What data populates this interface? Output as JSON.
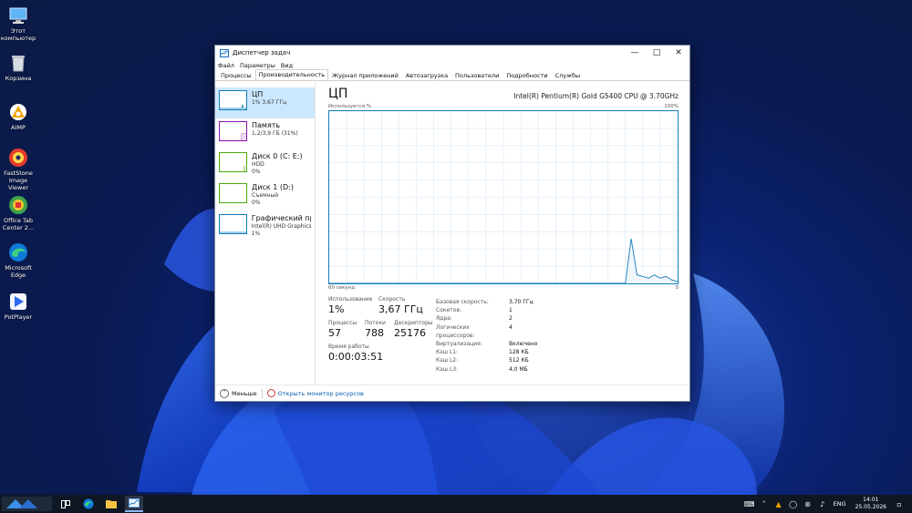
{
  "desktop": {
    "icons": [
      {
        "label": "Этот компьютер",
        "icon": "computer-icon"
      },
      {
        "label": "Корзина",
        "icon": "recycle-bin-icon"
      },
      {
        "label": "AIMP",
        "icon": "aimp-icon"
      },
      {
        "label": "FastStone Image Viewer",
        "icon": "faststone-icon"
      },
      {
        "label": "Office Tab Center 2...",
        "icon": "office-tab-icon"
      },
      {
        "label": "Microsoft Edge",
        "icon": "edge-icon"
      },
      {
        "label": "PotPlayer",
        "icon": "potplayer-icon"
      }
    ]
  },
  "window": {
    "title": "Диспетчер задач",
    "menu": [
      "Файл",
      "Параметры",
      "Вид"
    ],
    "tabs": [
      "Процессы",
      "Производительность",
      "Журнал приложений",
      "Автозагрузка",
      "Пользователи",
      "Подробности",
      "Службы"
    ],
    "active_tab": "Производительность",
    "sidebar": [
      {
        "name": "ЦП",
        "detail1": "1%  3,67 ГГц",
        "detail2": ""
      },
      {
        "name": "Память",
        "detail1": "1,2/3,9 ГБ (31%)",
        "detail2": ""
      },
      {
        "name": "Диск 0 (C: E:)",
        "detail1": "HDD",
        "detail2": "0%"
      },
      {
        "name": "Диск 1 (D:)",
        "detail1": "Съемный",
        "detail2": "0%"
      },
      {
        "name": "Графический про",
        "detail1": "Intel(R) UHD Graphics 6",
        "detail2": "1%"
      }
    ],
    "main": {
      "title": "ЦП",
      "cpu_name": "Intel(R) Pentium(R) Gold G5400 CPU @ 3.70GHz",
      "usage_label": "Используется %",
      "max_label": "100%",
      "time_label": "60 секунд",
      "min_label": "0",
      "usage_series": [
        0,
        0,
        0,
        0,
        0,
        0,
        0,
        0,
        0,
        0,
        0,
        0,
        0,
        0,
        0,
        0,
        0,
        0,
        0,
        0,
        0,
        0,
        0,
        0,
        0,
        0,
        0,
        0,
        0,
        0,
        0,
        0,
        0,
        0,
        0,
        0,
        0,
        0,
        0,
        0,
        0,
        0,
        0,
        0,
        0,
        0,
        0,
        0,
        0,
        0,
        0,
        0,
        26,
        5,
        4,
        3,
        5,
        3,
        4,
        2,
        1
      ],
      "stats": {
        "usage_label": "Использование",
        "usage_value": "1%",
        "speed_label": "Скорость",
        "speed_value": "3,67 ГГц",
        "processes_label": "Процессы",
        "processes_value": "57",
        "threads_label": "Потоки",
        "threads_value": "788",
        "handles_label": "Дескрипторы",
        "handles_value": "25176",
        "uptime_label": "Время работы",
        "uptime_value": "0:00:03:51"
      },
      "specs": [
        {
          "k": "Базовая скорость:",
          "v": "3,70 ГГц"
        },
        {
          "k": "Сокетов:",
          "v": "1"
        },
        {
          "k": "Ядра:",
          "v": "2"
        },
        {
          "k": "Логических процессоров:",
          "v": "4"
        },
        {
          "k": "Виртуализация:",
          "v": "Включено"
        },
        {
          "k": "Кэш L1:",
          "v": "128 КБ"
        },
        {
          "k": "Кэш L2:",
          "v": "512 КБ"
        },
        {
          "k": "Кэш L3:",
          "v": "4,0 МБ"
        }
      ]
    },
    "footer": {
      "less": "Меньше",
      "resmon": "Открыть монитор ресурсов"
    }
  },
  "taskbar": {
    "lang": "ENG",
    "time": "14:01",
    "date": "25.05.2026"
  },
  "colors": {
    "cpu": "#117dbb",
    "memory": "#8b12ae",
    "disk": "#4da60c",
    "gpu": "#117dbb"
  }
}
